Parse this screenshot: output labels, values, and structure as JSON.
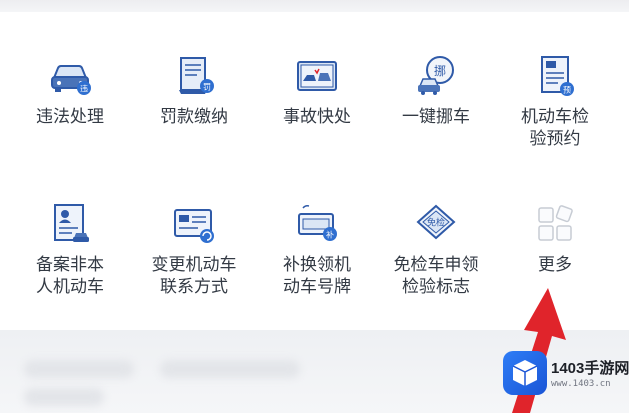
{
  "services": [
    {
      "label": "违法处理",
      "icon": "car-badge-icon"
    },
    {
      "label": "罚款缴纳",
      "icon": "receipt-badge-icon"
    },
    {
      "label": "事故快处",
      "icon": "accident-photo-icon"
    },
    {
      "label": "一键挪车",
      "icon": "move-car-icon",
      "badge": "挪"
    },
    {
      "label": "机动车检\n验预约",
      "icon": "inspection-doc-icon",
      "badge": "预"
    },
    {
      "label": "备案非本\n人机动车",
      "icon": "person-doc-car-icon"
    },
    {
      "label": "变更机动车\n联系方式",
      "icon": "change-contact-card-icon"
    },
    {
      "label": "补换领机\n动车号牌",
      "icon": "plate-replace-icon"
    },
    {
      "label": "免检车申领\n检验标志",
      "icon": "exempt-label-icon",
      "badge": "免检"
    },
    {
      "label": "更多",
      "icon": "more-grid-icon"
    }
  ],
  "watermark": {
    "title": "1403手游网",
    "url": "www.1403.cn"
  },
  "colors": {
    "icon_blue": "#2f5aa8",
    "icon_light": "#dbe6f5",
    "text": "#333a44",
    "arrow": "#e0242b"
  }
}
